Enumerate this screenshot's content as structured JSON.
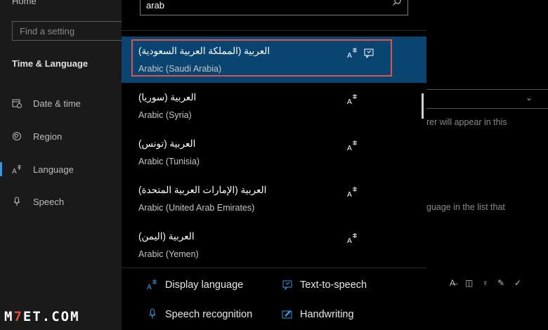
{
  "sidebar": {
    "home_label": "Home",
    "search_placeholder": "Find a setting",
    "section_title": "Time & Language",
    "items": [
      {
        "label": "Date & time",
        "icon": "calendar-clock-icon"
      },
      {
        "label": "Region",
        "icon": "globe-icon"
      },
      {
        "label": "Language",
        "icon": "language-icon",
        "selected": true
      },
      {
        "label": "Speech",
        "icon": "microphone-icon"
      }
    ]
  },
  "search": {
    "value": "arab"
  },
  "languages": [
    {
      "native": "العربية (المملكة العربية السعودية)",
      "english": "Arabic (Saudi Arabia)",
      "selected": true,
      "features": [
        "display-language",
        "text-to-speech"
      ]
    },
    {
      "native": "العربية (سوريا)",
      "english": "Arabic (Syria)",
      "features": [
        "display-language"
      ]
    },
    {
      "native": "العربية (تونس)",
      "english": "Arabic (Tunisia)",
      "features": [
        "display-language"
      ]
    },
    {
      "native": "العربية (الإمارات العربية المتحدة)",
      "english": "Arabic (United Arab Emirates)",
      "features": [
        "display-language"
      ]
    },
    {
      "native": "العربية (اليمن)",
      "english": "Arabic (Yemen)",
      "features": [
        "display-language"
      ]
    }
  ],
  "legend": {
    "display_language": "Display language",
    "text_to_speech": "Text-to-speech",
    "speech_recognition": "Speech recognition",
    "handwriting": "Handwriting"
  },
  "right_pane": {
    "text_1": "rer will appear in this",
    "text_2": "guage in the list that"
  },
  "watermark": {
    "prefix": "M",
    "seven": "7",
    "suffix": "ET.COM"
  },
  "colors": {
    "accent": "#3a96dd",
    "selected_row": "#0a4470",
    "highlight_border": "#d9534f"
  }
}
